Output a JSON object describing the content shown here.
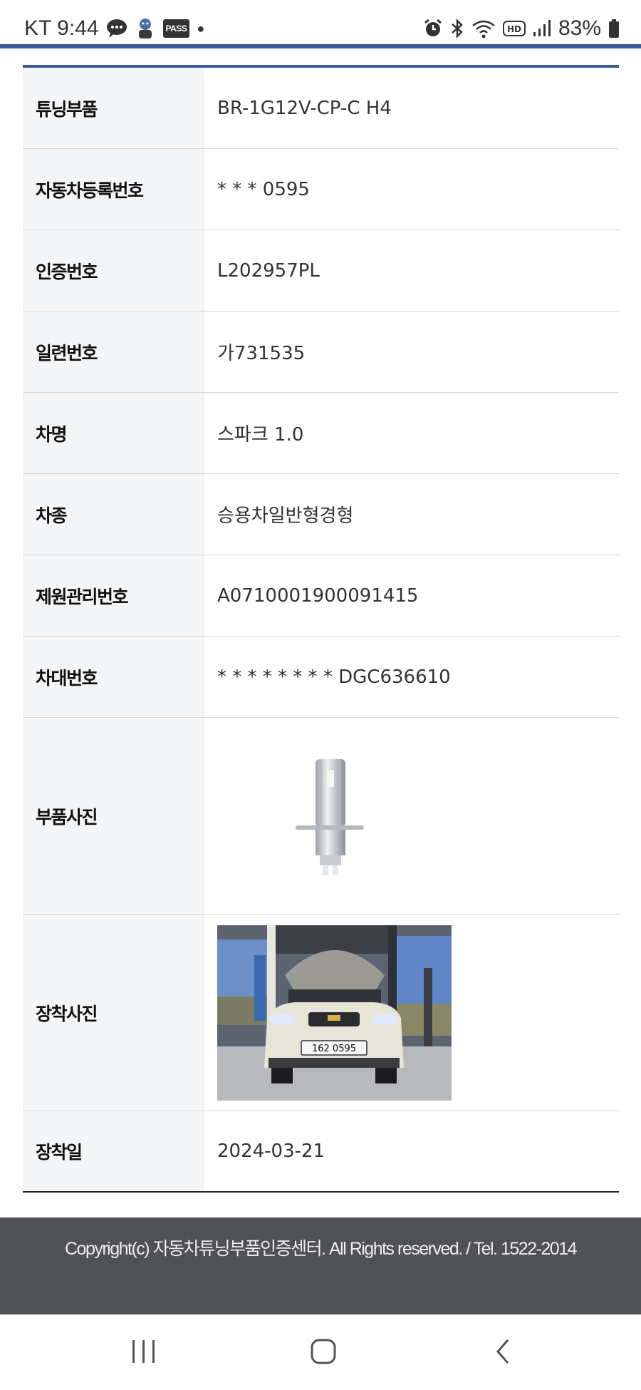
{
  "status_bar": {
    "carrier_time": "KT 9:44",
    "pass_label": "PASS",
    "battery": "83%"
  },
  "table": {
    "rows": [
      {
        "label": "튜닝부품",
        "value": "BR-1G12V-CP-C H4"
      },
      {
        "label": "자동차등록번호",
        "value": "* * * 0595"
      },
      {
        "label": "인증번호",
        "value": "L202957PL"
      },
      {
        "label": "일련번호",
        "value": "가731535"
      },
      {
        "label": "차명",
        "value": "스파크 1.0"
      },
      {
        "label": "차종",
        "value": "승용차일반형경형"
      },
      {
        "label": "제원관리번호",
        "value": "A0710001900091415"
      },
      {
        "label": "차대번호",
        "value": "* * * * * * * * DGC636610"
      }
    ],
    "part_photo_label": "부품사진",
    "install_photo_label": "장착사진",
    "install_date_label": "장착일",
    "install_date": "2024-03-21",
    "plate_text": "162 0595"
  },
  "footer": {
    "copyright": "Copyright(c) 자동차튜닝부품인증센터. All Rights reserved. / Tel. 1522-2014"
  },
  "colors": {
    "accent": "#3b5a9a",
    "footer_bg": "#4f5155",
    "label_bg": "#f4f5f7"
  },
  "icons": [
    "chat-icon",
    "avatar-icon",
    "alarm-icon",
    "bluetooth-icon",
    "wifi-icon",
    "hd-icon",
    "signal-icon",
    "battery-icon",
    "recent-apps-icon",
    "home-icon",
    "back-icon"
  ]
}
